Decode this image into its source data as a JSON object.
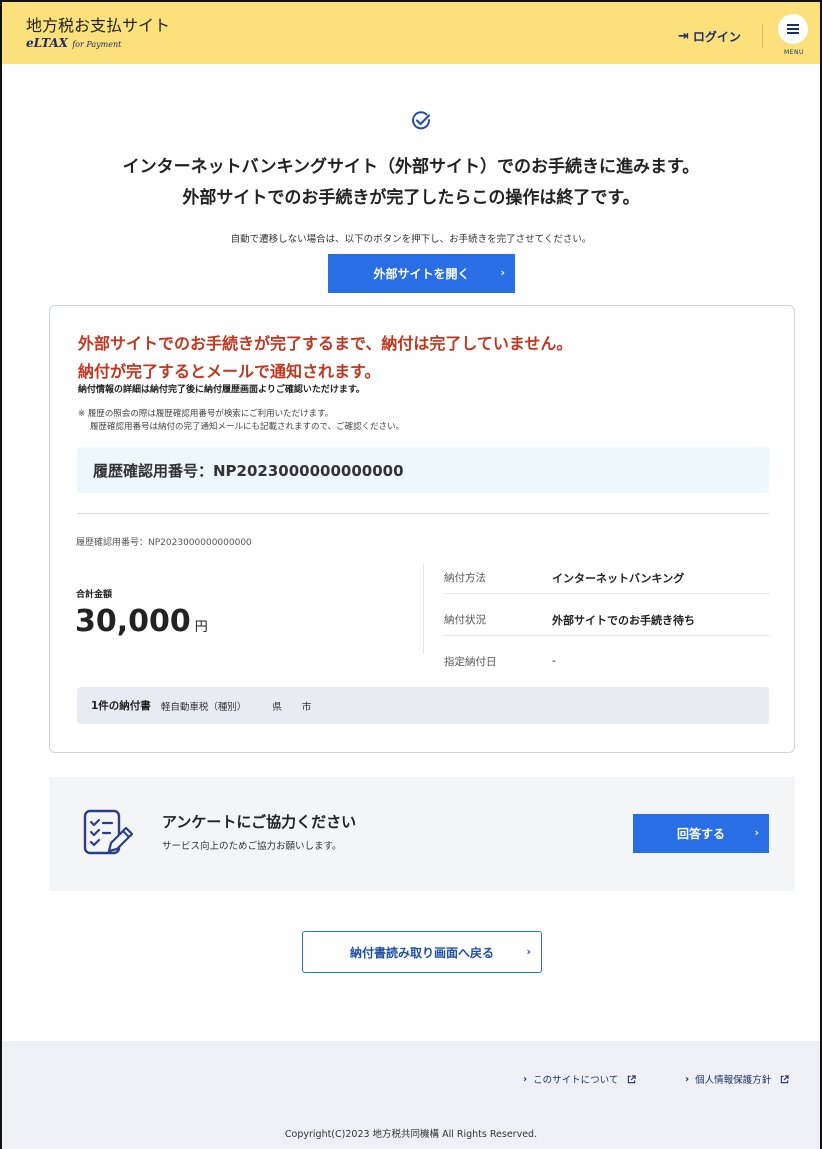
{
  "header": {
    "site_title": "地方税お支払サイト",
    "brand_main": "eLTAX",
    "brand_sub": "for Payment",
    "login_label": "ログイン",
    "menu_label": "MENU"
  },
  "hero": {
    "line1": "インターネットバンキングサイト（外部サイト）でのお手続きに進みます。",
    "line2": "外部サイトでのお手続きが完了したらこの操作は終了です。",
    "auto_note": "自動で遷移しない場合は、以下のボタンを押下し、お手続きを完了させてください。",
    "open_button": "外部サイトを開く"
  },
  "card": {
    "warning_line1": "外部サイトでのお手続きが完了するまで、納付は完了していません。",
    "warning_line2": "納付が完了するとメールで通知されます。",
    "detail_note": "納付情報の詳細は納付完了後に納付履歴画面よりご確認いただけます。",
    "small_note1": "※ 履歴の照会の際は履歴確認用番号が検索にご利用いただけます。",
    "small_note2": "履歴確認用番号は納付の完了通知メールにも記載されますので、ご確認ください。",
    "id_heading": "履歴確認用番号：NP2023000000000000",
    "id_small": "履歴確認用番号：NP2023000000000000",
    "total_label": "合計金額",
    "total_amount": "30,000",
    "total_unit": "円",
    "info": [
      {
        "key": "納付方法",
        "value": "インターネットバンキング"
      },
      {
        "key": "納付状況",
        "value": "外部サイトでのお手続き待ち"
      },
      {
        "key": "指定納付日",
        "value": "-"
      }
    ],
    "bill": {
      "count": "1件の納付書",
      "tax": "軽自動車税（種別）",
      "prefecture": "県",
      "city": "市"
    }
  },
  "survey": {
    "title": "アンケートにご協力ください",
    "subtitle": "サービス向上のためご協力お願いします。",
    "button": "回答する"
  },
  "back_button": "納付書読み取り画面へ戻る",
  "footer": {
    "link_about": "このサイトについて",
    "link_privacy": "個人情報保護方針",
    "copyright": "Copyright(C)2023 地方税共同機構 All Rights Reserved."
  },
  "colors": {
    "header_bg": "#fbe07c",
    "primary": "#2a6ee6",
    "warning": "#c0361f",
    "navy": "#1c2d6b"
  }
}
